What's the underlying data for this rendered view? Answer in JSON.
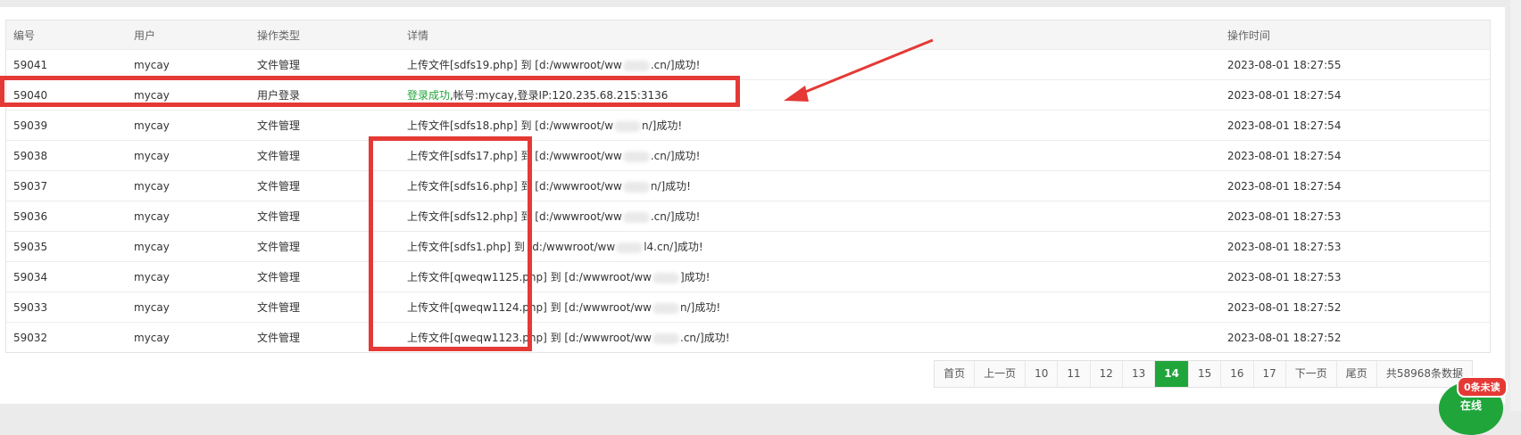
{
  "table": {
    "headers": {
      "id": "编号",
      "user": "用户",
      "type": "操作类型",
      "detail": "详情",
      "time": "操作时间"
    },
    "rows": [
      {
        "id": "59041",
        "user": "mycay",
        "type": "文件管理",
        "detail_a": "上传文件[sdfs19.php] 到 [d:/wwwroot/ww",
        "detail_b": ".cn/]成功!",
        "time": "2023-08-01 18:27:55"
      },
      {
        "id": "59040",
        "user": "mycay",
        "type": "用户登录",
        "detail_ok": "登录成功",
        "detail_rest": ",帐号:mycay,登录IP:120.235.68.215:3136",
        "time": "2023-08-01 18:27:54"
      },
      {
        "id": "59039",
        "user": "mycay",
        "type": "文件管理",
        "detail_a": "上传文件[sdfs18.php] 到 [d:/wwwroot/w",
        "detail_b": "n/]成功!",
        "time": "2023-08-01 18:27:54"
      },
      {
        "id": "59038",
        "user": "mycay",
        "type": "文件管理",
        "detail_a": "上传文件[sdfs17.php] 到 [d:/wwwroot/ww",
        "detail_b": ".cn/]成功!",
        "time": "2023-08-01 18:27:54"
      },
      {
        "id": "59037",
        "user": "mycay",
        "type": "文件管理",
        "detail_a": "上传文件[sdfs16.php] 到 [d:/wwwroot/ww",
        "detail_b": "n/]成功!",
        "time": "2023-08-01 18:27:54"
      },
      {
        "id": "59036",
        "user": "mycay",
        "type": "文件管理",
        "detail_a": "上传文件[sdfs12.php] 到 [d:/wwwroot/ww",
        "detail_b": ".cn/]成功!",
        "time": "2023-08-01 18:27:53"
      },
      {
        "id": "59035",
        "user": "mycay",
        "type": "文件管理",
        "detail_a": "上传文件[sdfs1.php] 到 [d:/wwwroot/ww",
        "detail_b": "l4.cn/]成功!",
        "time": "2023-08-01 18:27:53"
      },
      {
        "id": "59034",
        "user": "mycay",
        "type": "文件管理",
        "detail_a": "上传文件[qweqw1125.php] 到 [d:/wwwroot/ww",
        "detail_b": "]成功!",
        "time": "2023-08-01 18:27:53"
      },
      {
        "id": "59033",
        "user": "mycay",
        "type": "文件管理",
        "detail_a": "上传文件[qweqw1124.php] 到 [d:/wwwroot/ww",
        "detail_b": "n/]成功!",
        "time": "2023-08-01 18:27:52"
      },
      {
        "id": "59032",
        "user": "mycay",
        "type": "文件管理",
        "detail_a": "上传文件[qweqw1123.php] 到 [d:/wwwroot/ww",
        "detail_b": ".cn/]成功!",
        "time": "2023-08-01 18:27:52"
      }
    ]
  },
  "pager": {
    "first": "首页",
    "prev": "上一页",
    "pages": [
      "10",
      "11",
      "12",
      "13",
      "14",
      "15",
      "16",
      "17"
    ],
    "active": "14",
    "next": "下一页",
    "last": "尾页",
    "total": "共58968条数据"
  },
  "chat": {
    "unread": "0条未读",
    "status": "在线"
  },
  "colors": {
    "accent": "#20a53a",
    "annotation": "#e53935"
  }
}
